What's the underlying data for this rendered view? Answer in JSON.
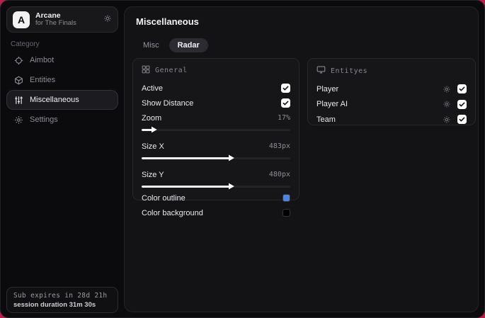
{
  "colors": {
    "backdrop_accent": "#bb1e4b",
    "window_bg": "#0b0b0e",
    "panel_bg": "#161619",
    "border": "#27272d",
    "text_primary": "#eaeaee",
    "text_muted": "#8d8d95",
    "checkbox_bg": "#ffffff",
    "tab_active_bg": "#2b2b31"
  },
  "sidebar": {
    "app": {
      "logo_letter": "A",
      "name": "Arcane",
      "subtitle": "for The Finals"
    },
    "category_label": "Category",
    "items": [
      {
        "label": "Aimbot",
        "icon": "crosshair-icon",
        "active": false
      },
      {
        "label": "Entities",
        "icon": "cube-icon",
        "active": false
      },
      {
        "label": "Miscellaneous",
        "icon": "sliders-icon",
        "active": true
      },
      {
        "label": "Settings",
        "icon": "gear-icon",
        "active": false
      }
    ],
    "footer": {
      "line1": "Sub expires in 28d 21h",
      "line2": "session duration 31m 30s"
    }
  },
  "main": {
    "title": "Miscellaneous",
    "tabs": [
      {
        "label": "Misc",
        "active": false
      },
      {
        "label": "Radar",
        "active": true
      }
    ],
    "general_panel": {
      "title": "General",
      "rows": [
        {
          "type": "checkbox",
          "label": "Active",
          "checked": true
        },
        {
          "type": "checkbox",
          "label": "Show Distance",
          "checked": true
        },
        {
          "type": "slider",
          "label": "Zoom",
          "value": "17%",
          "fill_pct": 7
        },
        {
          "type": "slider",
          "label": "Size X",
          "value": "483px",
          "fill_pct": 59
        },
        {
          "type": "slider",
          "label": "Size Y",
          "value": "480px",
          "fill_pct": 59
        },
        {
          "type": "color",
          "label": "Color outline",
          "swatch": "#4e84dc"
        },
        {
          "type": "color",
          "label": "Color background",
          "swatch": "#000000"
        }
      ]
    },
    "entities_panel": {
      "title": "Entityes",
      "rows": [
        {
          "label": "Player",
          "checked": true
        },
        {
          "label": "Player AI",
          "checked": true
        },
        {
          "label": "Team",
          "checked": true
        }
      ]
    }
  }
}
